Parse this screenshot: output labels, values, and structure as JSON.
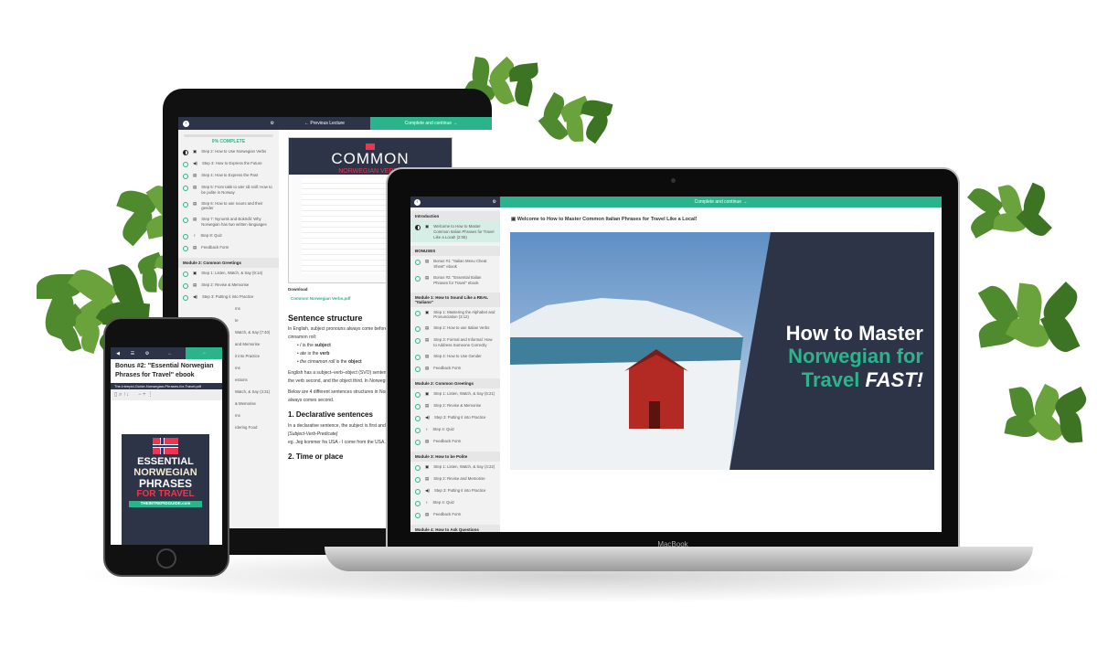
{
  "tablet": {
    "nav": {
      "prev": "← Previous Lecture",
      "next": "Complete and continue →"
    },
    "progress": "0% COMPLETE",
    "items": [
      {
        "label": "Step 2: How to Use Norwegian Verbs",
        "icon": "video",
        "state": "half"
      },
      {
        "label": "Step 3: How to Express the Future",
        "icon": "audio"
      },
      {
        "label": "Step 4: How to Express the Past",
        "icon": "doc"
      },
      {
        "label": "Step 5: From takk to vær så snill: How to be polite in Norway",
        "icon": "doc"
      },
      {
        "label": "Step 6: How to use nouns and their gender",
        "icon": "doc"
      },
      {
        "label": "Step 7: Nynorsk and Bokmål: Why Norwegian has two written languages",
        "icon": "doc"
      },
      {
        "label": "Step 8: Quiz",
        "icon": "quiz"
      },
      {
        "label": "Feedback Form",
        "icon": "doc"
      }
    ],
    "module2": {
      "title": "Module 2: Common Greetings",
      "items": [
        {
          "label": "Step 1: Listen, Watch, & Say (9:14)",
          "icon": "video"
        },
        {
          "label": "Step 2: Revise & Memorise",
          "icon": "doc"
        },
        {
          "label": "Step 3: Putting it into Practice",
          "icon": "audio"
        }
      ]
    },
    "partial": [
      "ms",
      "te",
      "Watch, & Say (7:40)",
      "and Memorise",
      "it into Practice",
      "ms",
      "estions",
      "Watch, & Say (3:31)",
      "& Memorise",
      "ms",
      "rdering Food"
    ],
    "banner": {
      "title": "COMMON",
      "subtitle": "NORWEGIAN VERBS"
    },
    "download_label": "Download",
    "download_link": "Common Norwegian Verbs.pdf",
    "article": {
      "h1": "Sentence structure",
      "p1": "In English, subject pronouns always come before the verb. For example, I ate the cinnamon roll:",
      "bullets": [
        {
          "a": "I",
          "b": " is the ",
          "c": "subject"
        },
        {
          "a": "ate",
          "b": " is the ",
          "c": "verb"
        },
        {
          "a": "the cinnamon roll",
          "b": " is the ",
          "c": "object"
        }
      ],
      "p2": "English has a subject–verb–object (SVO) sentence structure. The subject comes first, the verb second, and the object third. In Norwegian, things work a little bit differently.",
      "p3": "Below are 4 different sentences structures in Norwegian. In every question, the verb always comes second.",
      "h2": "1. Declarative sentences",
      "p4": "In a declarative sentence, the subject is first and the verb second.",
      "p5": "[Subject-Verb-Predicate]",
      "p6": "eg. Jeg kommer fra USA - I come from the USA.",
      "h3": "2. Time or place"
    }
  },
  "laptop": {
    "nav_next": "Complete and continue →",
    "lecture_title": "Welcome to How to Master Common Italian Phrases for Travel Like a Local!",
    "brand": "MacBook",
    "sections": [
      {
        "title": "Introduction",
        "items": [
          {
            "label": "Welcome to How to Master Common Italian Phrases for Travel Like a Local! (2:06)",
            "icon": "video",
            "state": "half",
            "active": true
          }
        ]
      },
      {
        "title": "BONUSES",
        "items": [
          {
            "label": "Bonus #1: \"Italian Menu Cheat Sheet\" ebook",
            "icon": "doc"
          },
          {
            "label": "Bonus #2: \"Essential Italian Phrases for Travel\" ebook",
            "icon": "doc"
          }
        ]
      },
      {
        "title": "Module 1: How to Sound Like a REAL \"Italiano\"",
        "items": [
          {
            "label": "Step 1: Mastering the Alphabet and Pronunciation (3:12)",
            "icon": "video"
          },
          {
            "label": "Step 2: How to use Italian Verbs",
            "icon": "doc"
          },
          {
            "label": "Step 3: Formal and Informal: How to Address Someone Correctly",
            "icon": "doc"
          },
          {
            "label": "Step 4: How to Use Gender",
            "icon": "doc"
          },
          {
            "label": "Feedback Form",
            "icon": "doc"
          }
        ]
      },
      {
        "title": "Module 2: Common Greetings",
        "items": [
          {
            "label": "Step 1: Listen, Watch, & Say (6:21)",
            "icon": "video"
          },
          {
            "label": "Step 2: Revise & Memorise",
            "icon": "doc"
          },
          {
            "label": "Step 3: Putting it into Practice",
            "icon": "audio"
          },
          {
            "label": "Step 4: Quiz",
            "icon": "quiz"
          },
          {
            "label": "Feedback Form",
            "icon": "doc"
          }
        ]
      },
      {
        "title": "Module 3: How to be Polite",
        "items": [
          {
            "label": "Step 1: Listen, Watch, & Say (4:22)",
            "icon": "video"
          },
          {
            "label": "Step 2: Revise and Memorise",
            "icon": "doc"
          },
          {
            "label": "Step 3: Putting it into Practice",
            "icon": "audio"
          },
          {
            "label": "Step 4: Quiz",
            "icon": "quiz"
          },
          {
            "label": "Feedback Form",
            "icon": "doc"
          }
        ]
      },
      {
        "title": "Module 4: How to Ask Questions",
        "items": []
      }
    ],
    "hero": {
      "line1": "How to Master",
      "line2": "Norwegian for",
      "line3a": "Travel ",
      "line3b": "FAST!"
    }
  },
  "phone": {
    "title": "Bonus #2: \"Essential Norwegian Phrases for Travel\" ebook",
    "file": "The-Intrepid-Guide-Norwegian-Phrases-for-Travel.pdf",
    "cover": {
      "l1": "ESSENTIAL",
      "l2": "NORWEGIAN",
      "l3": "PHRASES",
      "l4": "FOR TRAVEL",
      "site": "THEINTREPIDGUIDE.com"
    }
  },
  "colors": {
    "accent": "#2bb48c",
    "navy": "#2e3448",
    "red": "#e8384f"
  }
}
